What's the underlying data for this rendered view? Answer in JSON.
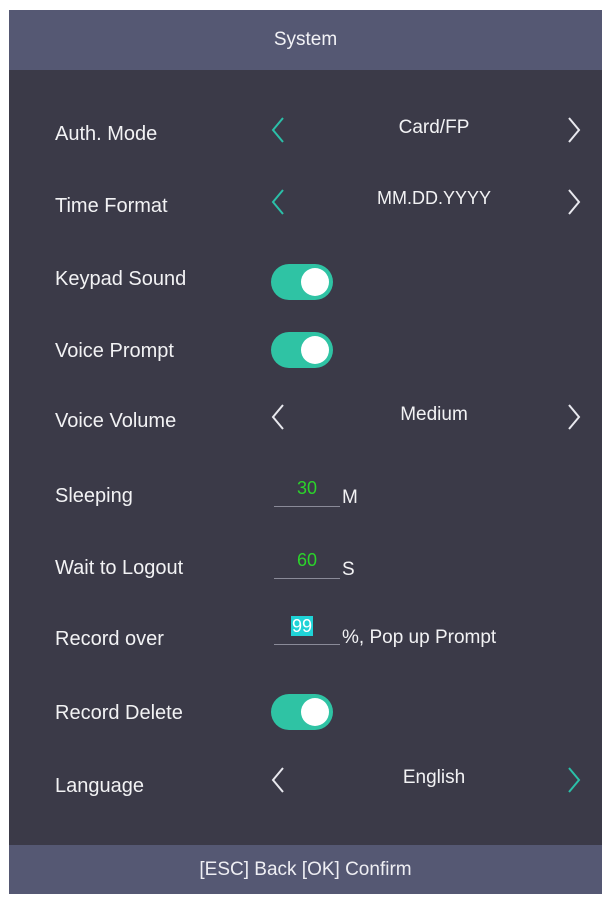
{
  "header": {
    "title": "System"
  },
  "rows": {
    "auth_mode": {
      "label": "Auth. Mode",
      "value": "Card/FP"
    },
    "time_format": {
      "label": "Time Format",
      "value": "MM.DD.YYYY"
    },
    "keypad_sound": {
      "label": "Keypad Sound",
      "enabled": true
    },
    "voice_prompt": {
      "label": "Voice Prompt",
      "enabled": true
    },
    "voice_volume": {
      "label": "Voice Volume",
      "value": "Medium"
    },
    "sleeping": {
      "label": "Sleeping",
      "value": "30",
      "unit": "M"
    },
    "wait_logout": {
      "label": "Wait to Logout",
      "value": "60",
      "unit": "S"
    },
    "record_over": {
      "label": "Record over",
      "value": "99",
      "unit": "%, Pop up Prompt"
    },
    "record_delete": {
      "label": "Record Delete",
      "enabled": true
    },
    "language": {
      "label": "Language",
      "value": "English"
    }
  },
  "footer": {
    "hint": "[ESC] Back [OK] Confirm"
  },
  "colors": {
    "background": "#3b3a48",
    "bar": "#555873",
    "toggle_on": "#2fc3a4",
    "accent_chevron": "#2bbfa8",
    "number_text": "#2bd32b",
    "selection": "#1fd3d7"
  }
}
